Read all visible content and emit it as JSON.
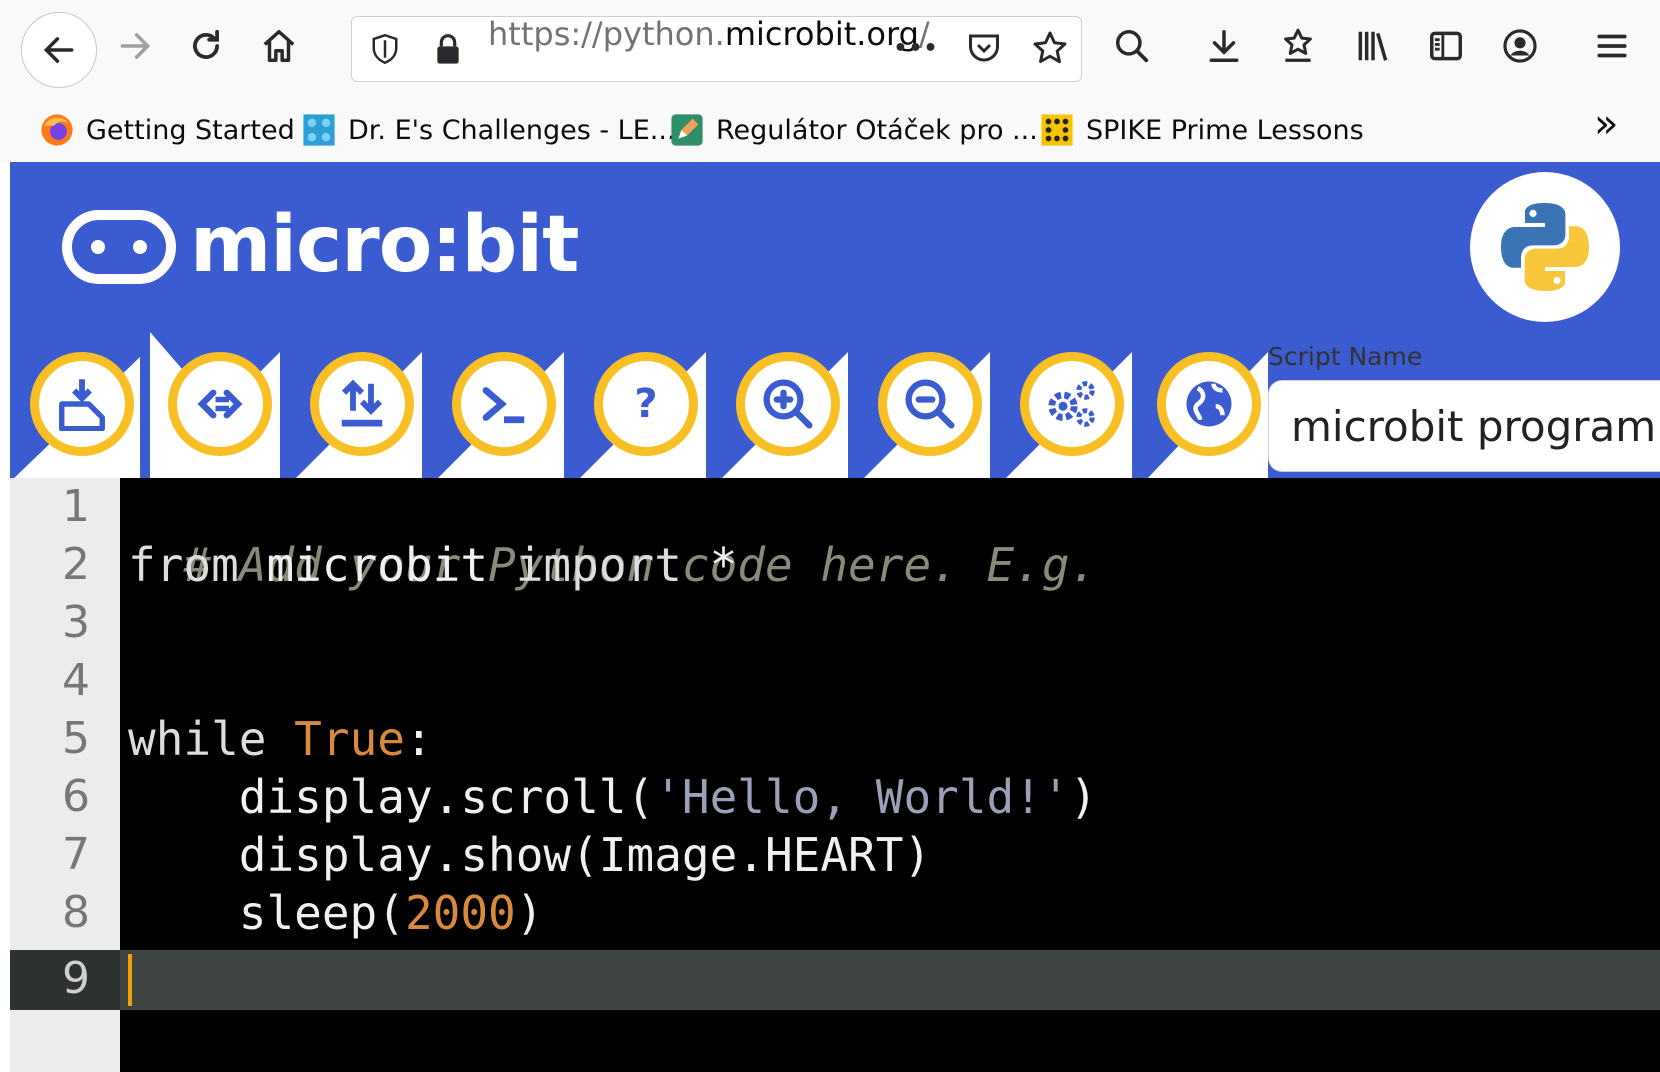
{
  "browser": {
    "url_prefix": "https://python.",
    "url_domain": "microbit.org",
    "url_suffix": "/",
    "more_label": "•••",
    "bookmarks": [
      {
        "label": "Getting Started",
        "icon": "firefox-icon"
      },
      {
        "label": "Dr. E's Challenges - LE...",
        "icon": "lego-icon"
      },
      {
        "label": "Regulátor Otáček pro ...",
        "icon": "pencil-icon"
      },
      {
        "label": "SPIKE Prime Lessons",
        "icon": "dice-icon"
      }
    ],
    "overflow_label": "»"
  },
  "app": {
    "logo_text": "micro:bit",
    "brand_color": "#3b5bd1",
    "accent_color": "#f9c026",
    "toolbar_buttons": [
      {
        "name": "download",
        "icon": "download-icon"
      },
      {
        "name": "connect",
        "icon": "connect-icon"
      },
      {
        "name": "load-save",
        "icon": "load-save-icon"
      },
      {
        "name": "repl",
        "icon": "terminal-icon"
      },
      {
        "name": "help",
        "icon": "help-icon",
        "glyph": "?"
      },
      {
        "name": "zoom-in",
        "icon": "zoom-in-icon"
      },
      {
        "name": "zoom-out",
        "icon": "zoom-out-icon"
      },
      {
        "name": "settings",
        "icon": "gear-icon"
      },
      {
        "name": "language",
        "icon": "globe-icon"
      }
    ],
    "script_name_label": "Script Name",
    "script_name_value": "microbit program"
  },
  "editor": {
    "line_numbers": [
      "1",
      "2",
      "3",
      "4",
      "5",
      "6",
      "7",
      "8",
      "9"
    ],
    "active_line": 9,
    "lines": {
      "l1_comment": "# Add your Python code here. E.g.",
      "l2_from": "from",
      "l2_module": " microbit ",
      "l2_import": "import",
      "l2_rest": " *",
      "l5_while": "while",
      "l5_true": " True",
      "l5_colon": ":",
      "l6_pre": "    display.scroll(",
      "l6_str": "'Hello, World!'",
      "l6_post": ")",
      "l7": "    display.show(Image.HEART)",
      "l8_pre": "    sleep(",
      "l8_num": "2000",
      "l8_post": ")"
    }
  }
}
